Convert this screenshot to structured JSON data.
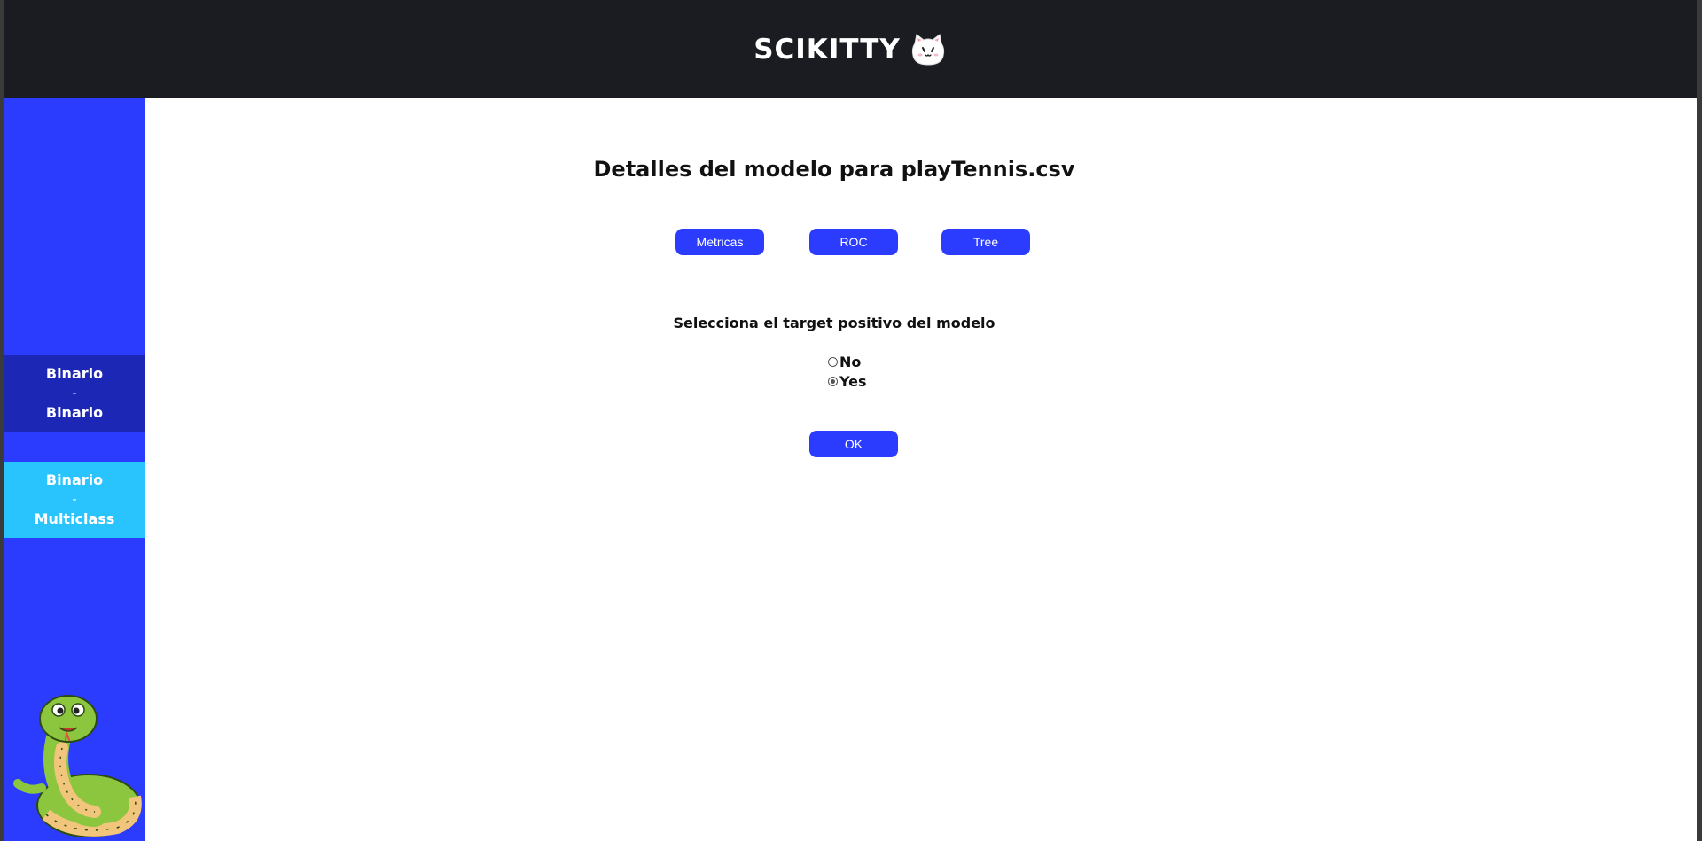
{
  "header": {
    "title": "SCIKITTY",
    "logo_icon": "cat-face-icon"
  },
  "sidebar": {
    "items": [
      {
        "top": "Binario",
        "separator": "-",
        "bottom": "Binario",
        "color": "#1d27b5"
      },
      {
        "top": "Binario",
        "separator": "-",
        "bottom": "Multiclass",
        "color": "#29c4fd"
      }
    ],
    "mascot_icon": "snake-mascot-icon",
    "background": "#2b3cff"
  },
  "main": {
    "title": "Detalles del modelo para playTennis.csv",
    "tabs": [
      {
        "label": "Metricas"
      },
      {
        "label": "ROC"
      },
      {
        "label": "Tree"
      }
    ],
    "question": "Selecciona el target positivo del modelo",
    "options": [
      {
        "label": "No",
        "checked": false
      },
      {
        "label": "Yes",
        "checked": true
      }
    ],
    "ok_label": "OK",
    "accent": "#2b3cff"
  }
}
